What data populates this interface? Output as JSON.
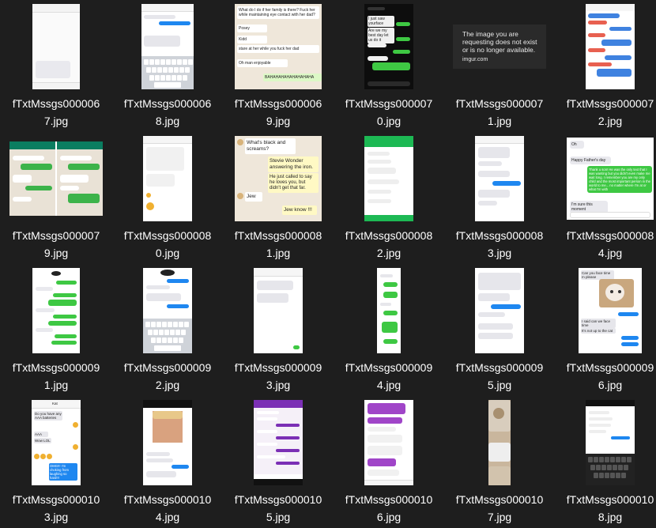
{
  "folder": {
    "view": "large-icons",
    "items": [
      {
        "name": "fTxtMssgs0000067.jpg",
        "label": "fTxtMssgs000006\n7.jpg"
      },
      {
        "name": "fTxtMssgs0000068.jpg",
        "label": "fTxtMssgs000006\n8.jpg"
      },
      {
        "name": "fTxtMssgs0000069.jpg",
        "label": "fTxtMssgs000006\n9.jpg"
      },
      {
        "name": "fTxtMssgs0000070.jpg",
        "label": "fTxtMssgs000007\n0.jpg"
      },
      {
        "name": "fTxtMssgs0000071.jpg",
        "label": "fTxtMssgs000007\n1.jpg"
      },
      {
        "name": "fTxtMssgs0000072.jpg",
        "label": "fTxtMssgs000007\n2.jpg"
      },
      {
        "name": "fTxtMssgs0000079.jpg",
        "label": "fTxtMssgs000007\n9.jpg"
      },
      {
        "name": "fTxtMssgs0000080.jpg",
        "label": "fTxtMssgs000008\n0.jpg"
      },
      {
        "name": "fTxtMssgs0000081.jpg",
        "label": "fTxtMssgs000008\n1.jpg"
      },
      {
        "name": "fTxtMssgs0000082.jpg",
        "label": "fTxtMssgs000008\n2.jpg"
      },
      {
        "name": "fTxtMssgs0000083.jpg",
        "label": "fTxtMssgs000008\n3.jpg"
      },
      {
        "name": "fTxtMssgs0000084.jpg",
        "label": "fTxtMssgs000008\n4.jpg"
      },
      {
        "name": "fTxtMssgs0000091.jpg",
        "label": "fTxtMssgs000009\n1.jpg"
      },
      {
        "name": "fTxtMssgs0000092.jpg",
        "label": "fTxtMssgs000009\n2.jpg"
      },
      {
        "name": "fTxtMssgs0000093.jpg",
        "label": "fTxtMssgs000009\n3.jpg"
      },
      {
        "name": "fTxtMssgs0000094.jpg",
        "label": "fTxtMssgs000009\n4.jpg"
      },
      {
        "name": "fTxtMssgs0000095.jpg",
        "label": "fTxtMssgs000009\n5.jpg"
      },
      {
        "name": "fTxtMssgs0000096.jpg",
        "label": "fTxtMssgs000009\n6.jpg"
      },
      {
        "name": "fTxtMssgs0000103.jpg",
        "label": "fTxtMssgs000010\n3.jpg"
      },
      {
        "name": "fTxtMssgs0000104.jpg",
        "label": "fTxtMssgs000010\n4.jpg"
      },
      {
        "name": "fTxtMssgs0000105.jpg",
        "label": "fTxtMssgs000010\n5.jpg"
      },
      {
        "name": "fTxtMssgs0000106.jpg",
        "label": "fTxtMssgs000010\n6.jpg"
      },
      {
        "name": "fTxtMssgs0000107.jpg",
        "label": "fTxtMssgs000010\n7.jpg"
      },
      {
        "name": "fTxtMssgs0000108.jpg",
        "label": "fTxtMssgs000010\n8.jpg"
      }
    ]
  },
  "thumbnails": {
    "t69": {
      "header": "What do I do if her family is there? Fuck her while maintaining eye contact with her dad?",
      "m1": "Posey",
      "m2": "Kidd",
      "m3": "stare at her while you fuck her dad",
      "m4": "Oh man enjoyable",
      "m5": "BAHAHAHAHAHAHAHAHA"
    },
    "t70": {
      "m1": "I just saw yourface",
      "m2": "Are we my best day let us do it"
    },
    "t71": {
      "line1": "The image you are",
      "line2": "requesting does not exist",
      "line3": "or is no longer available.",
      "site": "imgur.com"
    },
    "t81": {
      "m1": "What's black and screams?",
      "m2": "Stevie Wonder answering the iron.",
      "m3": "He just called to say he loves you, but didn't get that far.",
      "m4": "Jew",
      "m5": "Jew know !!!"
    },
    "t84": {
      "m1": "Oh",
      "m2": "Happy Father's day",
      "m3": "Thank u son! He was the only text that I was wanting but you didn't even make me wait long. I remember you are my only child and the most important person in the world to me... no matter where I'm at or what I'm with",
      "m4": "I'm sure this moment"
    },
    "t96": {
      "m1": "Can you face time m please",
      "m2": "I said can we face time",
      "m3": "It's not up to the cat"
    },
    "t103": {
      "header": "Kat",
      "m1": "Do you have any AAA batteries",
      "m2": "AAA",
      "m3": "Wow LOL",
      "m4": "OMG!!! I'm choking from laughing so hard!!!"
    }
  },
  "colors": {
    "background": "#1e1e1e",
    "label": "#ffffff",
    "imessage_blue": "#1e87f0",
    "sms_green": "#3ec843",
    "whatsapp_green": "#0a7d60",
    "purple": "#7b2fb5"
  }
}
